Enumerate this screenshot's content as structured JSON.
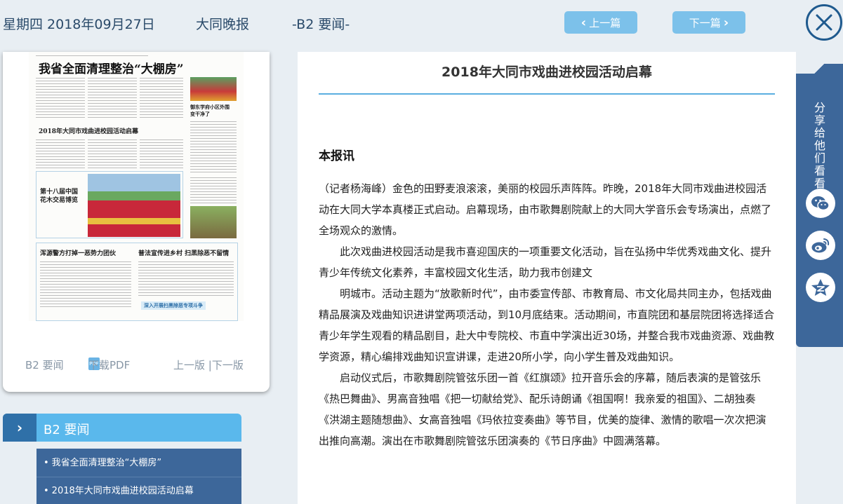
{
  "header": {
    "date": "星期四 2018年09月27日",
    "paper_name": "大同晚报",
    "page": "-B2 要闻-",
    "prev_label": "上一篇",
    "next_label": "下一篇"
  },
  "paper_preview": {
    "headline": "我省全面清理整治“大棚房”",
    "sub1": "2018年大同市戏曲进校园活动启幕",
    "sub2": "第十八届中国",
    "sub3": "花木交易博览",
    "sub4": "浑源警方打掉一恶势力团伙",
    "sub5": "普法宣传进乡村 扫黑除恶不留情",
    "sub6": "御东学府小区外围",
    "sub7": "变干净了",
    "banner": "深入开展扫黑除恶专项斗争"
  },
  "paper_links": {
    "section": "B2 要闻",
    "pdf_icon": "PDF",
    "download_pdf": "下载PDF",
    "prev_next_page": "上一版 |下一版"
  },
  "section_menu": {
    "title": "B2  要闻",
    "items": [
      {
        "label": "我省全面清理整治“大棚房”"
      },
      {
        "label": "2018年大同市戏曲进校园活动启幕"
      }
    ]
  },
  "article": {
    "title": "2018年大同市戏曲进校园活动启幕",
    "lead": "本报讯",
    "paragraphs": [
      "（记者杨海峰）金色的田野麦浪滚滚，美丽的校园乐声阵阵。昨晚，2018年大同市戏曲进校园活动在大同大学本真楼正式启动。启幕现场，由市歌舞剧院献上的大同大学音乐会专场演出，点燃了全场观众的激情。",
      "此次戏曲进校园活动是我市喜迎国庆的一项重要文化活动，旨在弘扬中华优秀戏曲文化、提升青少年传统文化素养，丰富校园文化生活，助力我市创建文",
      "明城市。活动主题为“放歌新时代”，由市委宣传部、市教育局、市文化局共同主办，包括戏曲精品展演及戏曲知识进讲堂两项活动，到10月底结束。活动期间，市直院团和基层院团将选择适合青少年学生观看的精品剧目，赴大中专院校、市直中学演出近30场，并整合我市戏曲资源、戏曲教学资源，精心编排戏曲知识宣讲课，走进20所小学，向小学生普及戏曲知识。",
      "启动仪式后，市歌舞剧院管弦乐团一首《红旗颂》拉开音乐会的序幕，随后表演的是管弦乐《热巴舞曲》、男高音独唱《把一切献给党》、配乐诗朗诵《祖国啊！我亲爱的祖国》、二胡独奏《洪湖主题随想曲》、女高音独唱《玛依拉变奏曲》等节目，优美的旋律、激情的歌唱一次次把演出推向高潮。演出在市歌舞剧院管弦乐团演奏的《节日序曲》中圆满落幕。"
    ]
  },
  "share": {
    "label": "分享给他们看看",
    "icons": [
      "wechat-icon",
      "weibo-icon",
      "qzone-icon"
    ]
  },
  "colors": {
    "accent": "#5ab8ec",
    "button": "#7cc1ea",
    "navy": "#3d679a",
    "close": "#1f5a8e"
  }
}
